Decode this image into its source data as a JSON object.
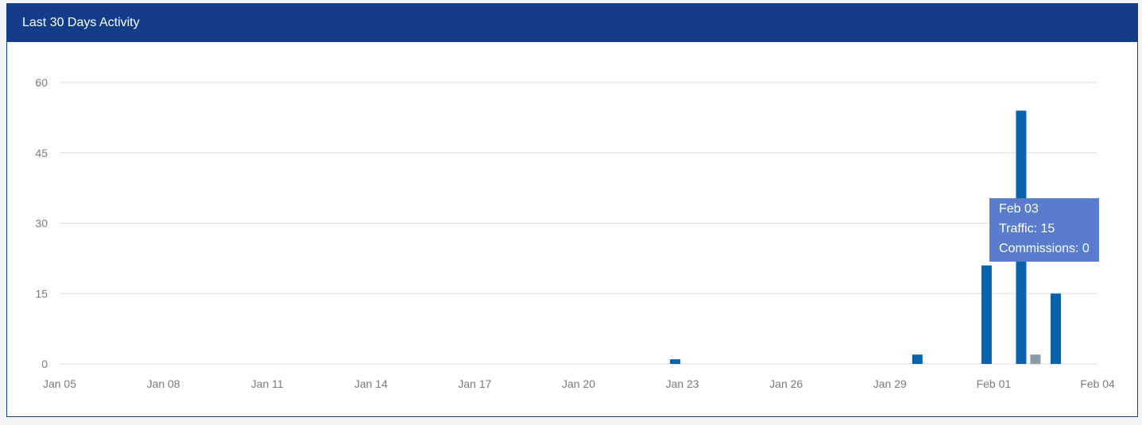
{
  "panel": {
    "title": "Last 30 Days Activity"
  },
  "chart_data": {
    "type": "bar",
    "title": "",
    "xlabel": "",
    "ylabel": "",
    "x_start": "Jan 05",
    "x_end": "Feb 04",
    "xticks": [
      "Jan 05",
      "Jan 08",
      "Jan 11",
      "Jan 14",
      "Jan 17",
      "Jan 20",
      "Jan 23",
      "Jan 26",
      "Jan 29",
      "Feb 01",
      "Feb 04"
    ],
    "yticks": [
      0,
      15,
      30,
      45,
      60
    ],
    "ylim": [
      0,
      60
    ],
    "grid": true,
    "series": [
      {
        "name": "Traffic",
        "color": "#0a63aa",
        "points": [
          {
            "x": "Jan 23",
            "y": 1
          },
          {
            "x": "Jan 30",
            "y": 2
          },
          {
            "x": "Feb 01",
            "y": 21
          },
          {
            "x": "Feb 02",
            "y": 54
          },
          {
            "x": "Feb 03",
            "y": 15
          }
        ]
      },
      {
        "name": "Commissions",
        "color": "#8a9ba8",
        "points": [
          {
            "x": "Feb 02",
            "y": 2
          }
        ]
      }
    ]
  },
  "tooltip": {
    "date": "Feb 03",
    "traffic_text": "Traffic: 15",
    "commissions_text": "Commissions: 0"
  },
  "colors": {
    "header": "#133d88",
    "tooltip": "#5a7ccd",
    "grid": "#dcdcdc"
  }
}
